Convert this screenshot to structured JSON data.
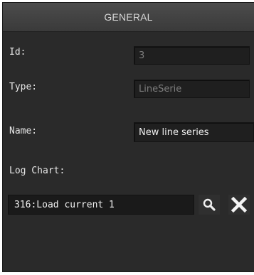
{
  "panel": {
    "title": "GENERAL"
  },
  "fields": {
    "id": {
      "label": "Id:",
      "value": "3"
    },
    "type": {
      "label": "Type:",
      "value": "LineSerie"
    },
    "name": {
      "label": "Name:",
      "value": "New line series"
    },
    "log_chart": {
      "label": "Log Chart:",
      "value": "316:Load current 1"
    }
  },
  "icons": {
    "search": "search-icon",
    "clear": "close-icon"
  }
}
